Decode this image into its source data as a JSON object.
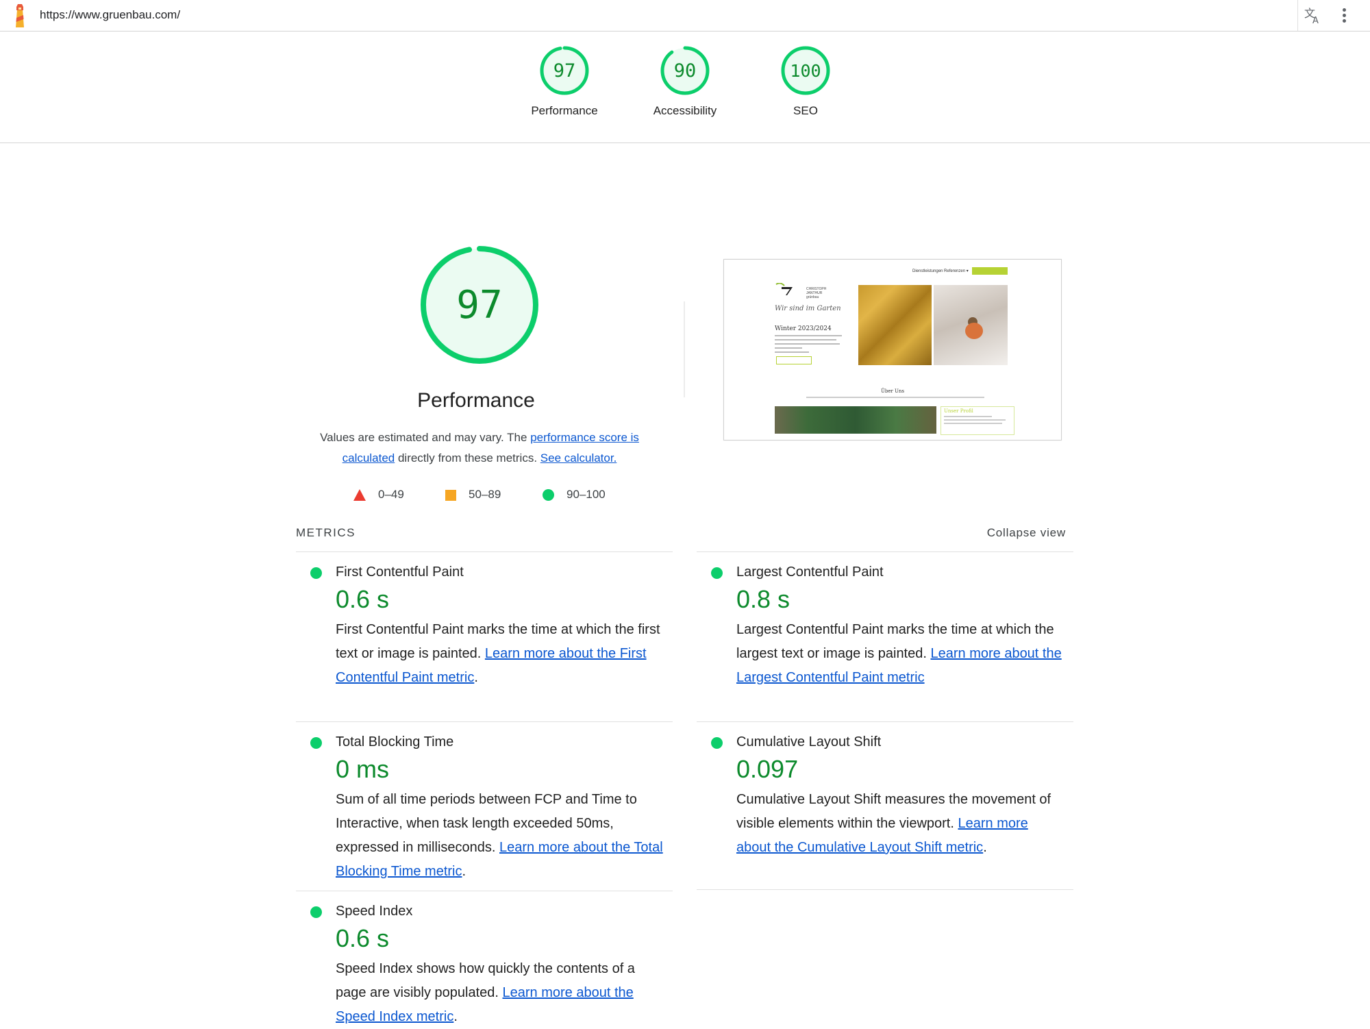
{
  "browser": {
    "url": "https://www.gruenbau.com/",
    "icons": {
      "logo": "lighthouse-icon",
      "translate": "translate-icon",
      "menu": "kebab-menu-icon"
    }
  },
  "summary": {
    "gauges": [
      {
        "score": "97",
        "label": "Performance"
      },
      {
        "score": "90",
        "label": "Accessibility"
      },
      {
        "score": "100",
        "label": "SEO"
      }
    ]
  },
  "performance": {
    "score": "97",
    "title": "Performance",
    "desc_prefix": "Values are estimated and may vary. The ",
    "desc_link1": "performance score is calculated",
    "desc_middle": " directly from these metrics. ",
    "desc_link2": "See calculator."
  },
  "legend": [
    {
      "shape": "triangle",
      "range": "0–49",
      "color": "#eb3b30"
    },
    {
      "shape": "square",
      "range": "50–89",
      "color": "#f6a623"
    },
    {
      "shape": "circle",
      "range": "90–100",
      "color": "#0cce6b"
    }
  ],
  "thumbnail": {
    "nav": "Dienstleistungen   Referenzen ▾",
    "brand_line1": "CHRISTOPH",
    "brand_line2": "JANTHUR",
    "brand_line3": "grünbau",
    "script": "Wir sind im Garten",
    "heading": "Winter 2023/2024",
    "about": "Über Uns",
    "profile": "Unser Profil"
  },
  "metrics": {
    "header": "METRICS",
    "collapse": "Collapse view",
    "items": [
      {
        "title": "First Contentful Paint",
        "value": "0.6 s",
        "text": "First Contentful Paint marks the time at which the first text or image is painted. ",
        "link": "Learn more about the First Contentful Paint metric",
        "tail": "."
      },
      {
        "title": "Largest Contentful Paint",
        "value": "0.8 s",
        "text": "Largest Contentful Paint marks the time at which the largest text or image is painted. ",
        "link": "Learn more about the Largest Contentful Paint metric",
        "tail": ""
      },
      {
        "title": "Total Blocking Time",
        "value": "0 ms",
        "text": "Sum of all time periods between FCP and Time to Interactive, when task length exceeded 50ms, expressed in milliseconds. ",
        "link": "Learn more about the Total Blocking Time metric",
        "tail": "."
      },
      {
        "title": "Cumulative Layout Shift",
        "value": "0.097",
        "text": "Cumulative Layout Shift measures the movement of visible elements within the viewport. ",
        "link": "Learn more about the Cumulative Layout Shift metric",
        "tail": "."
      },
      {
        "title": "Speed Index",
        "value": "0.6 s",
        "text": "Speed Index shows how quickly the contents of a page are visibly populated. ",
        "link": "Learn more about the Speed Index metric",
        "tail": "."
      }
    ]
  },
  "colors": {
    "good": "#0cce6b",
    "good_text": "#0c8a2c",
    "link": "#0b57d0"
  }
}
